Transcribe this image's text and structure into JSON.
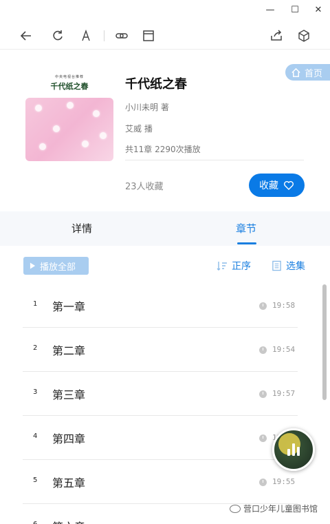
{
  "window": {
    "minimize": "—",
    "maximize": "☐",
    "close": "✕"
  },
  "toolbar": {
    "icons": [
      "back-arrow-icon",
      "refresh-icon",
      "font-size-icon",
      "link-icon",
      "window-icon",
      "share-icon",
      "cube-icon"
    ]
  },
  "home_badge": {
    "label": "首页",
    "icon": "home-icon"
  },
  "book": {
    "cover_series": "中央电视台推荐",
    "cover_title": "千代纸之春",
    "title": "千代纸之春",
    "author": "小川未明 著",
    "narrator": "艾威 播",
    "stats": "共11章  2290次播放",
    "favorites": "23人收藏",
    "favorite_button": "收藏"
  },
  "tabs": [
    {
      "label": "详情",
      "active": false
    },
    {
      "label": "章节",
      "active": true
    }
  ],
  "controls": {
    "play_all": "播放全部",
    "order": "正序",
    "select": "选集"
  },
  "chapters": [
    {
      "num": "1",
      "title": "第一章",
      "duration": "19:58"
    },
    {
      "num": "2",
      "title": "第二章",
      "duration": "19:54"
    },
    {
      "num": "3",
      "title": "第三章",
      "duration": "19:57"
    },
    {
      "num": "4",
      "title": "第四章",
      "duration": "19:55"
    },
    {
      "num": "5",
      "title": "第五章",
      "duration": "19:55"
    },
    {
      "num": "6",
      "title": "第六章",
      "duration": ""
    }
  ],
  "watermark": "营口少年儿童图书馆",
  "colors": {
    "accent": "#1a7fe0",
    "favorite_button": "#0a7ae6",
    "badge": "#a9cdf0",
    "cover_pink": "#f3b6d3"
  }
}
